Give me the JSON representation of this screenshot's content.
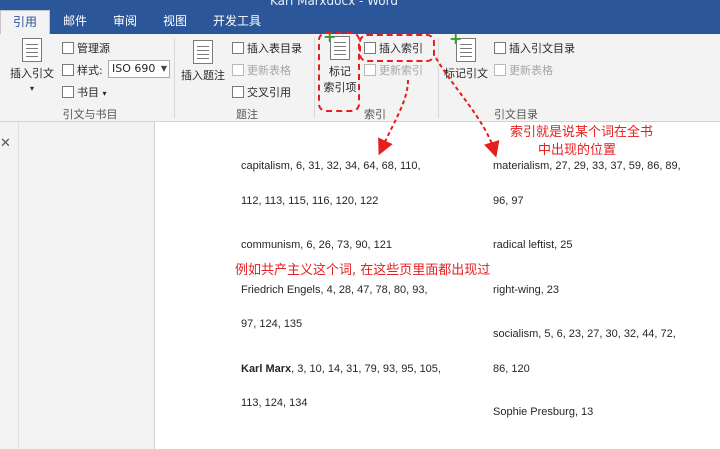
{
  "window": {
    "title": "Karl Marxdocx - Word"
  },
  "tabs": [
    "引用",
    "邮件",
    "审阅",
    "视图",
    "开发工具"
  ],
  "ribbon": {
    "citations": {
      "insert_citation": "插入引文",
      "manage_sources": "管理源",
      "style_label": "样式:",
      "style_value": "ISO 690",
      "bibliography": "书目",
      "group_label": "引文与书目"
    },
    "captions": {
      "insert_caption": "插入题注",
      "insert_table_of_figures": "插入表目录",
      "update_table": "更新表格",
      "cross_reference": "交叉引用",
      "group_label": "题注"
    },
    "index": {
      "mark_entry_line1": "标记",
      "mark_entry_line2": "索引项",
      "insert_index": "插入索引",
      "update_index": "更新索引",
      "group_label": "索引"
    },
    "table_of_authorities": {
      "mark_citation": "标记引文",
      "insert_table_of_authorities": "插入引文目录",
      "update_table": "更新表格",
      "group_label": "引文目录"
    }
  },
  "index_entries": {
    "left": [
      "capitalism, 6, 31, 32, 34, 64, 68, 110,",
      "112, 113, 115, 116, 120, 122",
      "communism, 6, 26, 73, 90, 121",
      "Friedrich Engels, 4, 28, 47, 78, 80, 93,",
      "97, 124, 135",
      "Karl Marx",
      ", 3, 10, 14, 31, 79, 93, 95, 105,",
      "113, 124, 134"
    ],
    "right": [
      "materialism, 27, 29, 33, 37, 59, 86, 89,",
      "96, 97",
      "radical leftist, 25",
      "right-wing, 23",
      "socialism, 5, 6, 23, 27, 30, 32, 44, 72,",
      "86, 120",
      "Sophie Presburg, 13"
    ]
  },
  "annotations": {
    "index_meaning_line1": "索引就是说某个词在全书",
    "index_meaning_line2": "中出现的位置",
    "example": "例如共产主义这个词, 在这些页里面都出现过"
  },
  "colors": {
    "accent": "#2b579a",
    "annotation": "#e61e1e"
  },
  "icons": [
    "close-icon",
    "document-icon",
    "dropdown-arrow-icon"
  ]
}
